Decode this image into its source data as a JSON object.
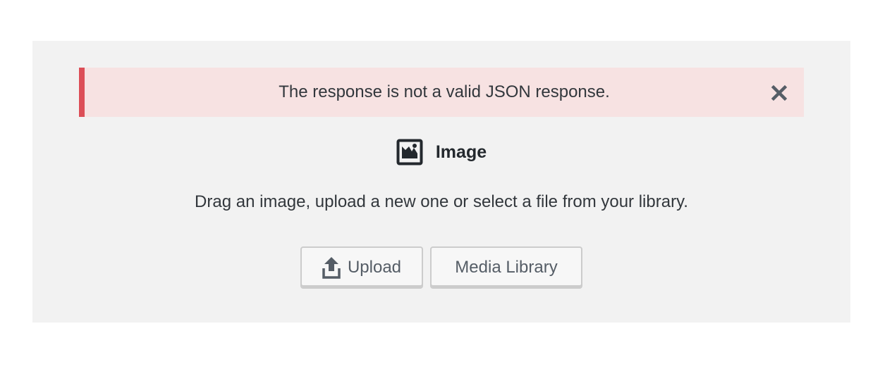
{
  "notice": {
    "message": "The response is not a valid JSON response.",
    "close_icon": "close-icon",
    "colors": {
      "background": "#f7e2e2",
      "border": "#dc4e57"
    }
  },
  "block": {
    "title": "Image",
    "icon": "image-icon",
    "instructions": "Drag an image, upload a new one or select a file from your library."
  },
  "buttons": {
    "upload_label": "Upload",
    "upload_icon": "upload-icon",
    "media_library_label": "Media Library"
  }
}
